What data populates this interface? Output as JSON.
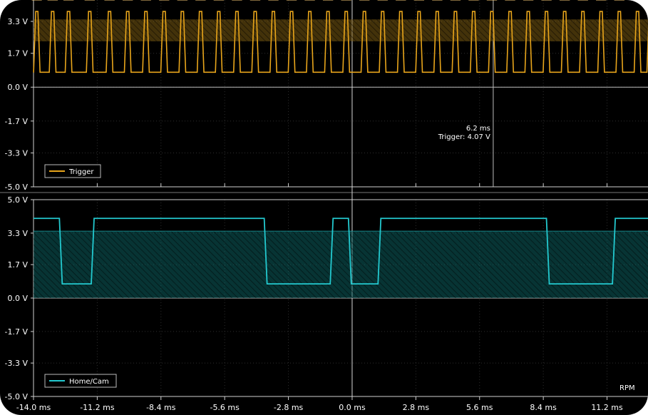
{
  "colors": {
    "trigger": "#e8a51b",
    "trigger_band": "#7a5a12",
    "cam": "#23c9cf",
    "cam_band": "#0c5f5f",
    "grid": "#3a3a3a",
    "axis": "#cfcfcf",
    "background": "#000000"
  },
  "chart_data": [
    {
      "type": "line",
      "legend": "Trigger",
      "ylim": [
        -5.0,
        3.8
      ],
      "y_tick_labels": [
        "3.3 V",
        "1.7 V",
        "0.0 V",
        "-1.7 V",
        "-3.3 V",
        "-5.0 V"
      ],
      "y_ticks": [
        3.3,
        1.7,
        0.0,
        -1.7,
        -3.3,
        -5.0
      ],
      "threshold_band": [
        2.3,
        3.4
      ],
      "marker_level": 1.95,
      "signal": {
        "high": 3.8,
        "low": 0.75,
        "edges_ms": [
          -14.0,
          -13.95,
          -13.76,
          -13.26,
          -13.06,
          -12.56,
          -12.36,
          -11.63,
          -11.43,
          -10.76,
          -10.56,
          -9.96,
          -9.76,
          -9.16,
          -8.96,
          -8.36,
          -8.16,
          -7.56,
          -7.36,
          -6.76,
          -6.56,
          -5.96,
          -5.76,
          -5.16,
          -4.96,
          -4.36,
          -4.16,
          -3.56,
          -3.36,
          -2.76,
          -2.56,
          -1.96,
          -1.76,
          -1.16,
          -0.96,
          -0.36,
          -0.16,
          0.44,
          0.64,
          1.24,
          1.44,
          2.04,
          2.24,
          2.84,
          3.04,
          3.64,
          3.84,
          4.44,
          4.64,
          5.24,
          5.44,
          6.04,
          6.24,
          6.84,
          7.04,
          7.64,
          7.84,
          8.44,
          8.64,
          9.24,
          9.44,
          10.04,
          10.24,
          10.84,
          11.04,
          11.64,
          11.84,
          12.44,
          12.64,
          13.0
        ],
        "start_state": "low",
        "gap_lows_ms": [
          [
            -13.06,
            -11.63
          ],
          [
            1.24,
            2.04
          ]
        ]
      },
      "annotation": {
        "x_ms": 6.2,
        "time_label": "6.2 ms",
        "value_label": "Trigger: 4.07 V"
      }
    },
    {
      "type": "line",
      "legend": "Home/Cam",
      "ylim": [
        -5.0,
        5.0
      ],
      "y_tick_labels": [
        "5.0 V",
        "3.3 V",
        "1.7 V",
        "0.0 V",
        "-1.7 V",
        "-3.3 V",
        "-5.0 V"
      ],
      "y_ticks": [
        5.0,
        3.3,
        1.7,
        0.0,
        -1.7,
        -3.3,
        -5.0
      ],
      "threshold_band": [
        0.0,
        3.4
      ],
      "signal": {
        "high": 4.05,
        "low": 0.72,
        "transitions_ms": [
          [
            -14.0,
            "high"
          ],
          [
            -12.8,
            "low"
          ],
          [
            -11.4,
            "high"
          ],
          [
            -3.8,
            "low"
          ],
          [
            -0.9,
            "high"
          ],
          [
            -0.1,
            "low"
          ],
          [
            1.2,
            "high"
          ],
          [
            8.6,
            "low"
          ],
          [
            11.5,
            "high"
          ],
          [
            13.0,
            "high"
          ]
        ]
      },
      "x_tick_labels": [
        "-14.0 ms",
        "-11.2 ms",
        "-8.4 ms",
        "-5.6 ms",
        "-2.8 ms",
        "0.0 ms",
        "2.8 ms",
        "5.6 ms",
        "8.4 ms",
        "11.2 ms"
      ],
      "x_ticks": [
        -14.0,
        -11.2,
        -8.4,
        -5.6,
        -2.8,
        0.0,
        2.8,
        5.6,
        8.4,
        11.2
      ],
      "xlim": [
        -14.0,
        13.0
      ],
      "corner_label": "RPM"
    }
  ]
}
